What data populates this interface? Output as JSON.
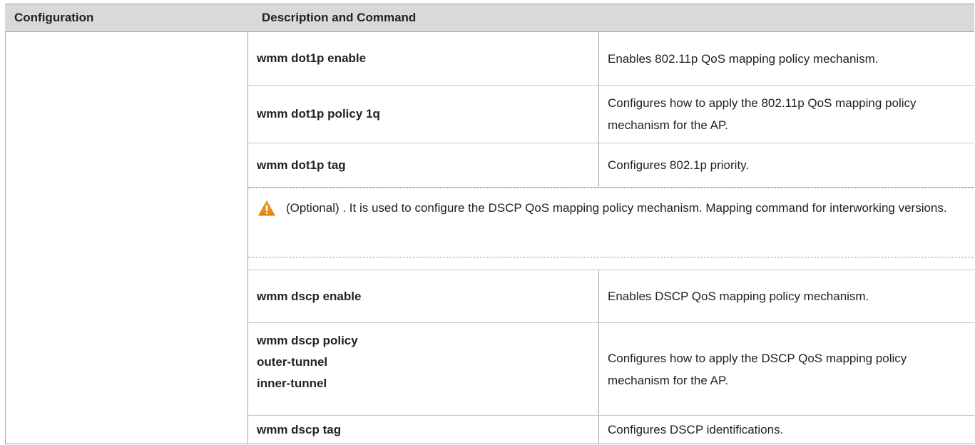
{
  "header": {
    "col1": "Configuration",
    "col2": "Description and Command"
  },
  "rows": [
    {
      "command": "wmm dot1p enable",
      "description": "Enables 802.11p QoS mapping policy mechanism."
    },
    {
      "command": "wmm dot1p policy 1q",
      "description": "Configures how to apply the 802.11p QoS mapping policy mechanism for the AP."
    },
    {
      "command": "wmm dot1p tag",
      "description": "Configures 802.1p priority."
    },
    {
      "command": "wmm dscp enable",
      "description": "Enables DSCP QoS mapping policy mechanism."
    },
    {
      "command_lines": [
        "wmm dscp policy",
        "outer-tunnel",
        "inner-tunnel"
      ],
      "description": "Configures how to apply the DSCP QoS mapping policy mechanism for the AP."
    },
    {
      "command": "wmm dscp tag",
      "description": "Configures DSCP identifications."
    }
  ],
  "note": {
    "icon": "warning-icon",
    "text": "(Optional) . It is used to configure the DSCP QoS mapping policy mechanism. Mapping command for interworking versions."
  },
  "colors": {
    "header_bg": "#d9d9d9",
    "warning_orange": "#f39c12"
  }
}
